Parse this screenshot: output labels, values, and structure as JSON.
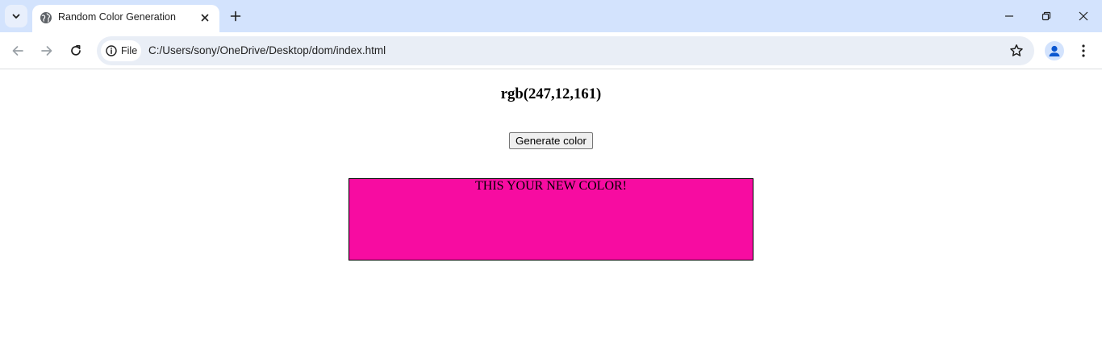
{
  "browser": {
    "tab": {
      "title": "Random Color Generation"
    },
    "address_bar": {
      "security_chip": "File",
      "url": "C:/Users/sony/OneDrive/Desktop/dom/index.html"
    },
    "icons": {
      "tab_search": "chevron-down-icon",
      "favicon": "globe-icon",
      "tab_close": "close-icon",
      "new_tab": "plus-icon",
      "minimize": "minimize-icon",
      "restore": "restore-icon",
      "close_window": "close-icon",
      "back": "back-arrow-icon",
      "forward": "forward-arrow-icon",
      "reload": "reload-icon",
      "info": "info-icon",
      "bookmark": "star-icon",
      "profile": "person-icon",
      "menu": "more-vert-icon"
    }
  },
  "page": {
    "color_value": "rgb(247,12,161)",
    "button_label": "Generate color",
    "box_text": "THIS YOUR NEW COLOR!",
    "colors": {
      "generated": "#f70ca1"
    }
  }
}
